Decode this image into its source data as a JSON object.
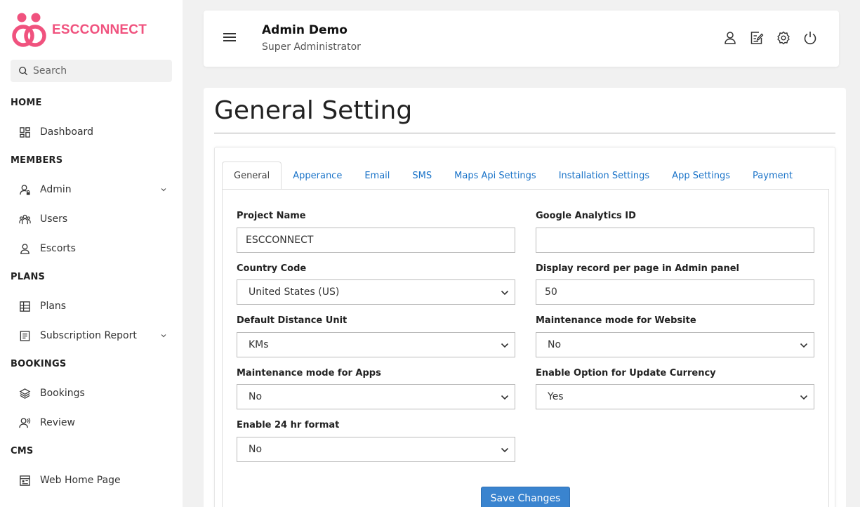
{
  "brand": {
    "name": "ESCCONNECT",
    "color": "#f0527e"
  },
  "search": {
    "placeholder": "Search"
  },
  "sidebar": {
    "sections": [
      {
        "title": "HOME",
        "items": [
          {
            "label": "Dashboard",
            "icon": "dashboard-icon"
          }
        ]
      },
      {
        "title": "MEMBERS",
        "items": [
          {
            "label": "Admin",
            "icon": "admin-user-icon",
            "expandable": true
          },
          {
            "label": "Users",
            "icon": "users-icon"
          },
          {
            "label": "Escorts",
            "icon": "person-icon"
          }
        ]
      },
      {
        "title": "PLANS",
        "items": [
          {
            "label": "Plans",
            "icon": "table-grid-icon"
          },
          {
            "label": "Subscription Report",
            "icon": "report-icon",
            "expandable": true
          }
        ]
      },
      {
        "title": "BOOKINGS",
        "items": [
          {
            "label": "Bookings",
            "icon": "layers-icon"
          },
          {
            "label": "Review",
            "icon": "review-icon"
          }
        ]
      },
      {
        "title": "CMS",
        "items": [
          {
            "label": "Web Home Page",
            "icon": "web-page-icon"
          }
        ]
      }
    ]
  },
  "header": {
    "user_name": "Admin Demo",
    "user_role": "Super Administrator",
    "icons": [
      "profile-icon",
      "edit-note-icon",
      "settings-icon",
      "power-icon"
    ]
  },
  "page": {
    "title": "General Setting"
  },
  "tabs": [
    {
      "label": "General",
      "active": true
    },
    {
      "label": "Apperance"
    },
    {
      "label": "Email"
    },
    {
      "label": "SMS"
    },
    {
      "label": "Maps Api Settings"
    },
    {
      "label": "Installation Settings"
    },
    {
      "label": "App Settings"
    },
    {
      "label": "Payment"
    }
  ],
  "form": {
    "project_name": {
      "label": "Project Name",
      "value": "ESCCONNECT"
    },
    "google_analytics": {
      "label": "Google Analytics ID",
      "value": ""
    },
    "country_code": {
      "label": "Country Code",
      "value": "United States (US)"
    },
    "records_per_page": {
      "label": "Display record per page in Admin panel",
      "value": "50"
    },
    "distance_unit": {
      "label": "Default Distance Unit",
      "value": "KMs"
    },
    "maintenance_website": {
      "label": "Maintenance mode for Website",
      "value": "No"
    },
    "maintenance_apps": {
      "label": "Maintenance mode for Apps",
      "value": "No"
    },
    "update_currency": {
      "label": "Enable Option for Update Currency",
      "value": "Yes"
    },
    "hr_format": {
      "label": "Enable 24 hr format",
      "value": "No"
    },
    "save_label": "Save Changes"
  },
  "colors": {
    "accent": "#3a84cf",
    "link": "#1a73c8"
  }
}
